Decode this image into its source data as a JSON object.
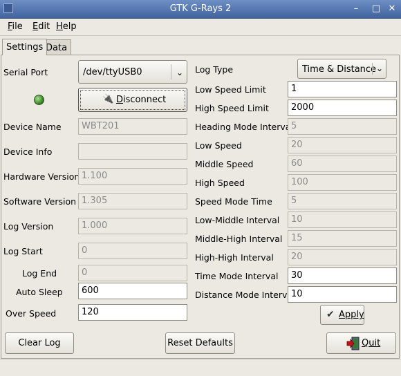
{
  "window": {
    "title": "GTK G-Rays 2",
    "minimize": "–",
    "maximize": "□",
    "close": "✕"
  },
  "menu": [
    "File",
    "Edit",
    "Help"
  ],
  "menu_mnemonics": [
    "F",
    "E",
    "H"
  ],
  "tabs": [
    "Settings",
    "Data"
  ],
  "left": {
    "serial_port_label": "Serial Port",
    "serial_port_value": "/dev/ttyUSB0",
    "disconnect_label": "Disconnect",
    "disconnect_mnemonic": "D",
    "device_name_label": "Device Name",
    "device_name_value": "WBT201",
    "device_info_label": "Device Info",
    "device_info_value": "",
    "hardware_version_label": "Hardware Version",
    "hardware_version_value": "1.100",
    "software_version_label": "Software Version",
    "software_version_value": "1.305",
    "log_version_label": "Log Version",
    "log_version_value": "1.000",
    "log_start_label": "Log Start",
    "log_start_value": "0",
    "log_end_label": "Log End",
    "log_end_value": "0",
    "auto_sleep_label": "Auto Sleep",
    "auto_sleep_value": "600",
    "over_speed_label": "Over Speed",
    "over_speed_value": "120"
  },
  "right": {
    "log_type_label": "Log Type",
    "log_type_value": "Time & Distance",
    "low_speed_limit_label": "Low Speed Limit",
    "low_speed_limit_value": "1",
    "high_speed_limit_label": "High Speed Limit",
    "high_speed_limit_value": "2000",
    "heading_mode_interval_label": "Heading Mode Interval",
    "heading_mode_interval_value": "5",
    "low_speed_label": "Low Speed",
    "low_speed_value": "20",
    "middle_speed_label": "Middle Speed",
    "middle_speed_value": "60",
    "high_speed_label": "High Speed",
    "high_speed_value": "100",
    "speed_mode_time_label": "Speed Mode Time",
    "speed_mode_time_value": "5",
    "low_middle_interval_label": "Low-Middle Interval",
    "low_middle_interval_value": "10",
    "middle_high_interval_label": "Middle-High Interval",
    "middle_high_interval_value": "15",
    "high_high_interval_label": "High-High Interval",
    "high_high_interval_value": "20",
    "time_mode_interval_label": "Time Mode Interval",
    "time_mode_interval_value": "30",
    "distance_mode_interval_label": "Distance Mode Interval",
    "distance_mode_interval_value": "10",
    "apply_label": "Apply"
  },
  "buttons": {
    "clear_log": "Clear Log",
    "reset_defaults": "Reset Defaults",
    "quit": "Quit"
  },
  "colors": {
    "titlebar": "#41639f",
    "status_led": "#3f8a2a",
    "quit_icon": "#c0141a"
  }
}
